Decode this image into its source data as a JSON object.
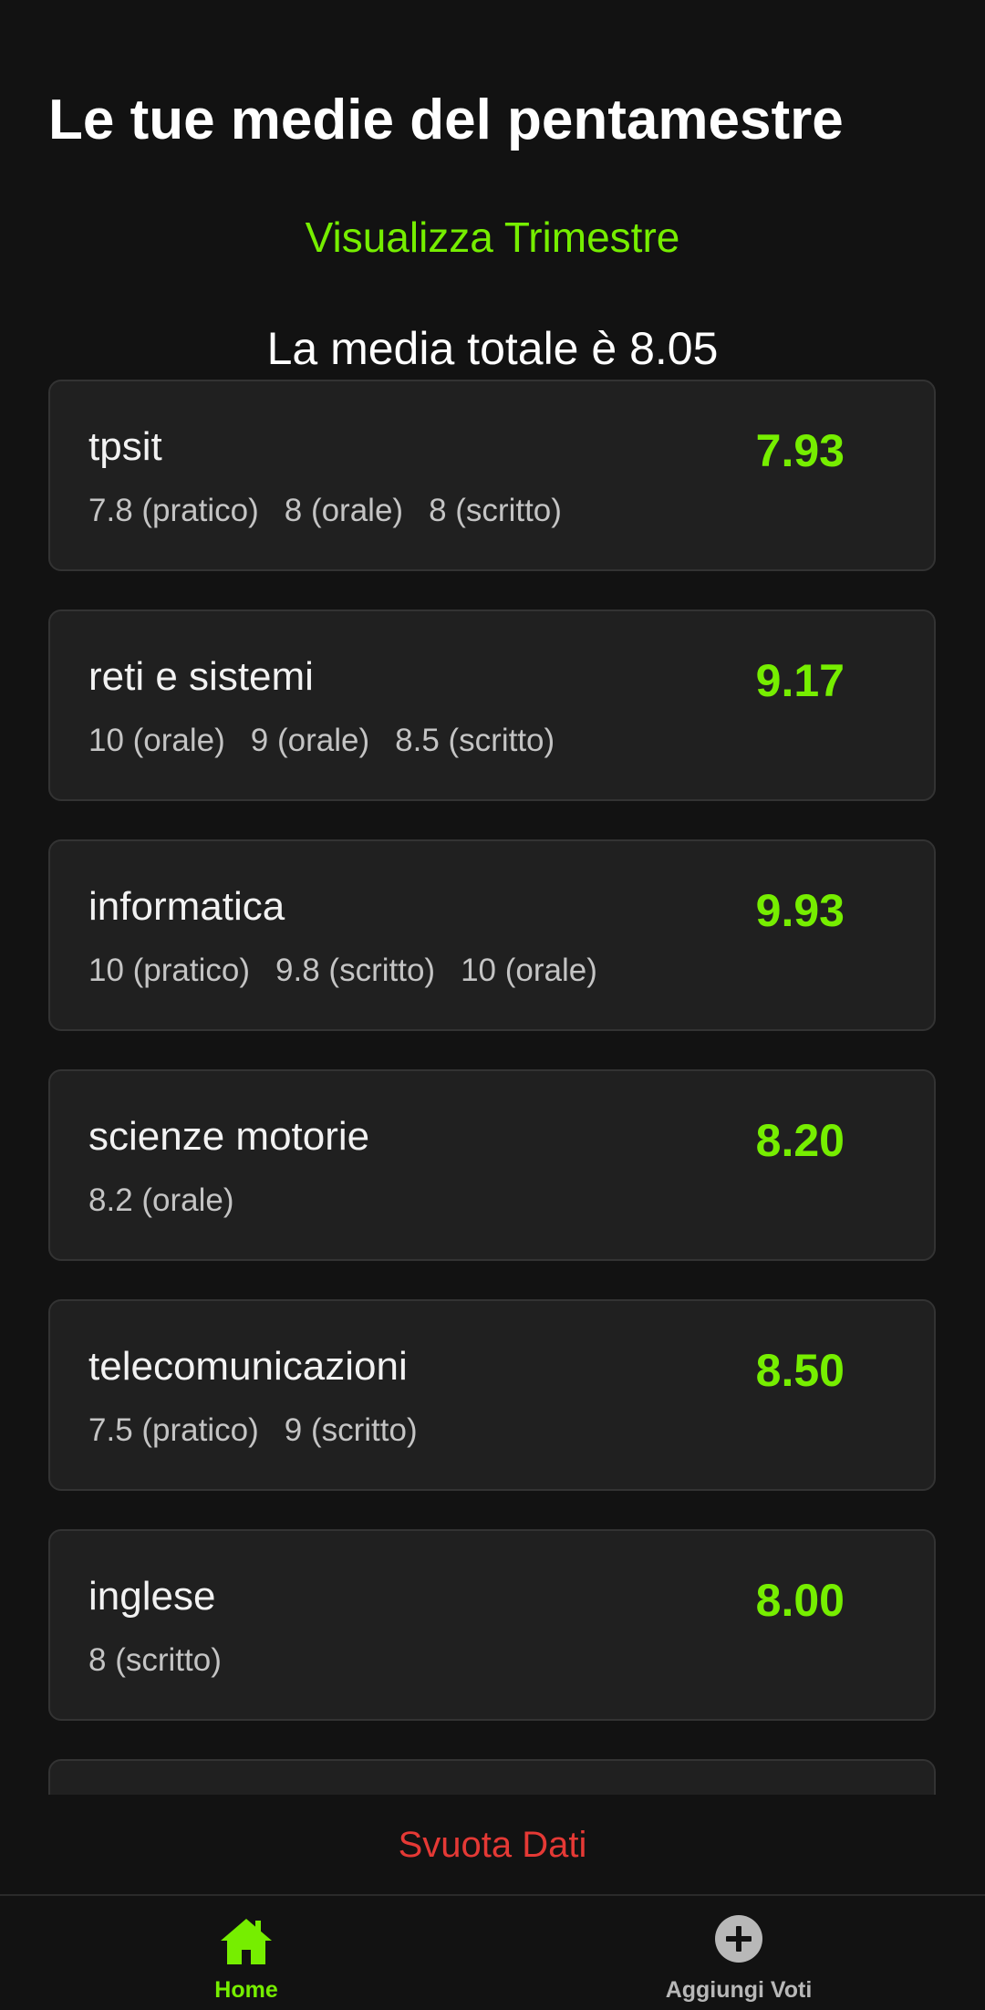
{
  "header": {
    "title": "Le tue medie del pentamestre",
    "toggle_label": "Visualizza Trimestre",
    "total_average_text": "La media totale è 8.05"
  },
  "subjects": [
    {
      "name": "tpsit",
      "average": "7.93",
      "grades": [
        "7.8 (pratico)",
        "8 (orale)",
        "8 (scritto)"
      ]
    },
    {
      "name": "reti e sistemi",
      "average": "9.17",
      "grades": [
        "10 (orale)",
        "9 (orale)",
        "8.5 (scritto)"
      ]
    },
    {
      "name": "informatica",
      "average": "9.93",
      "grades": [
        "10 (pratico)",
        "9.8 (scritto)",
        "10 (orale)"
      ]
    },
    {
      "name": "scienze motorie",
      "average": "8.20",
      "grades": [
        "8.2 (orale)"
      ]
    },
    {
      "name": "telecomunicazioni",
      "average": "8.50",
      "grades": [
        "7.5 (pratico)",
        "9 (scritto)"
      ]
    },
    {
      "name": "inglese",
      "average": "8.00",
      "grades": [
        "8 (scritto)"
      ]
    }
  ],
  "reset_button": {
    "label": "Svuota Dati"
  },
  "bottom_nav": {
    "home": {
      "label": "Home",
      "icon": "home-icon"
    },
    "add": {
      "label": "Aggiungi Voti",
      "icon": "add-circle-icon"
    }
  },
  "colors": {
    "background": "#121212",
    "card": "#202020",
    "accent": "#76ee00",
    "danger": "#e53935",
    "muted_text": "#c4c4c4"
  }
}
